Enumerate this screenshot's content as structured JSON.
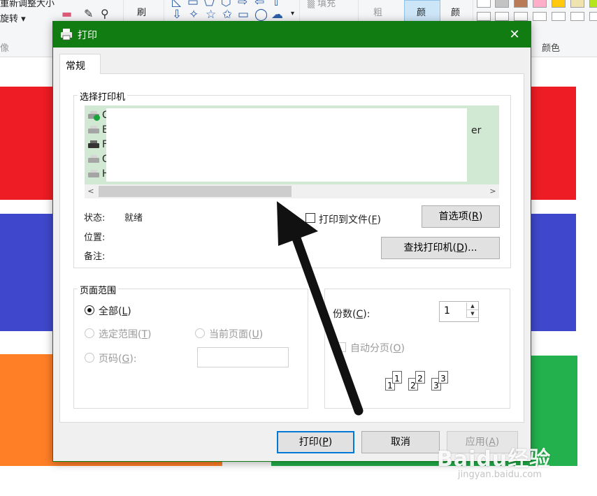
{
  "background": {
    "ribbon": {
      "resize_label": "重新调整大小",
      "rotate_label": "旋转",
      "brush_label": "刷",
      "fill_label": "填充",
      "thickness_label": "粗",
      "color1_label": "颜",
      "color2_label": "颜",
      "colors_group_label": "颜色",
      "image_group_label": "像"
    },
    "colors": {
      "band_red": "#ee1c24",
      "band_blue": "#3f48cc",
      "band_orange": "#ff7f27",
      "band_green": "#22b14c"
    }
  },
  "dialog": {
    "title": "打印",
    "title_bar_color": "#117c12",
    "tab_label": "常规",
    "select_printer_group": "选择打印机",
    "printers": [
      {
        "name": "C",
        "default": true
      },
      {
        "name": "El",
        "default": false
      },
      {
        "name": "Fa",
        "default": false
      },
      {
        "name": "G",
        "default": false
      },
      {
        "name": "H",
        "default": false
      }
    ],
    "printer_name_suffix": "er",
    "status_label": "状态:",
    "status_value": "就绪",
    "location_label": "位置:",
    "comment_label": "备注:",
    "print_to_file_label": "打印到文件(",
    "print_to_file_key": "F",
    "preferences_label": "首选项(",
    "preferences_key": "R",
    "find_printer_label": "查找打印机(",
    "find_printer_key": "D",
    "find_printer_suffix": ")...",
    "page_range_group": "页面范围",
    "range_all_label": "全部(",
    "range_all_key": "L",
    "range_selection_label": "选定范围(",
    "range_selection_key": "T",
    "range_current_label": "当前页面(",
    "range_current_key": "U",
    "range_pages_label": "页码(",
    "range_pages_key": "G",
    "range_pages_colon": "):",
    "copies_label": "份数(",
    "copies_key": "C",
    "copies_colon": "):",
    "copies_value": "1",
    "collate_label": "自动分页(",
    "collate_key": "O",
    "collate_pages": [
      "1",
      "1",
      "2",
      "2",
      "3",
      "3"
    ],
    "print_button": "打印(",
    "print_key": "P",
    "cancel_button": "取消",
    "apply_button": "应用(",
    "apply_key": "A",
    "close_paren": ")"
  },
  "watermark": {
    "brand": "Baidu经验",
    "url": "jingyan.baidu.com"
  }
}
